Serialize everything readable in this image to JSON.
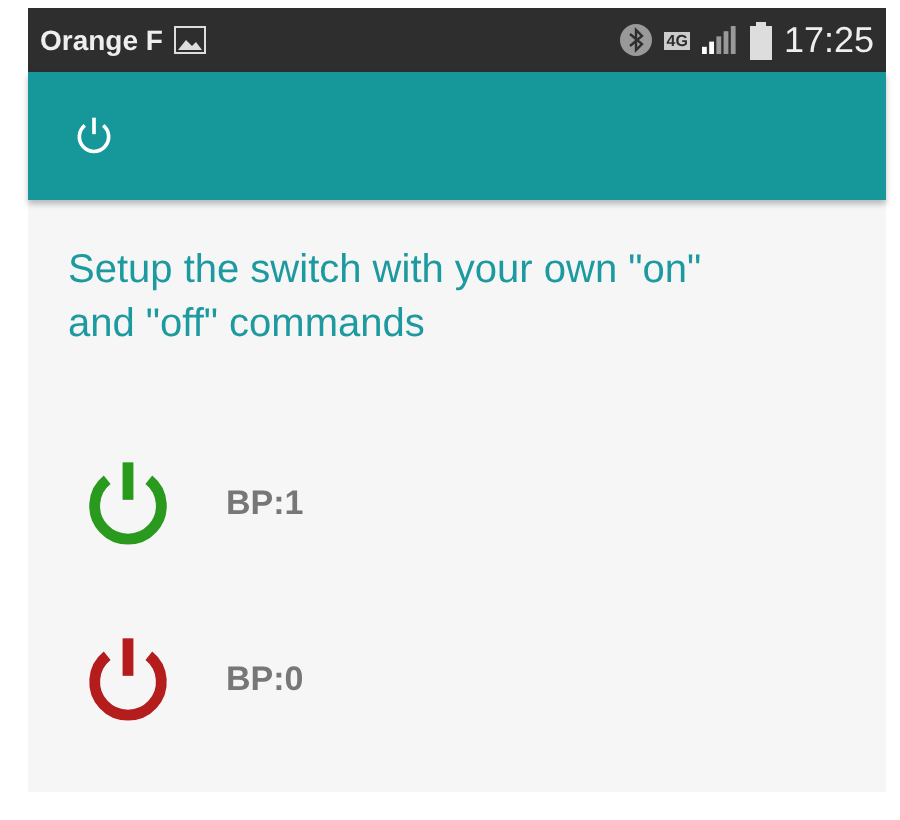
{
  "status_bar": {
    "carrier": "Orange F",
    "network_type": "4G",
    "time": "17:25"
  },
  "prompt": "Setup the switch with your own \"on\" and \"off\" commands",
  "commands": [
    {
      "color": "#2a9a1e",
      "label": "BP:1"
    },
    {
      "color": "#b51c1c",
      "label": "BP:0"
    }
  ]
}
